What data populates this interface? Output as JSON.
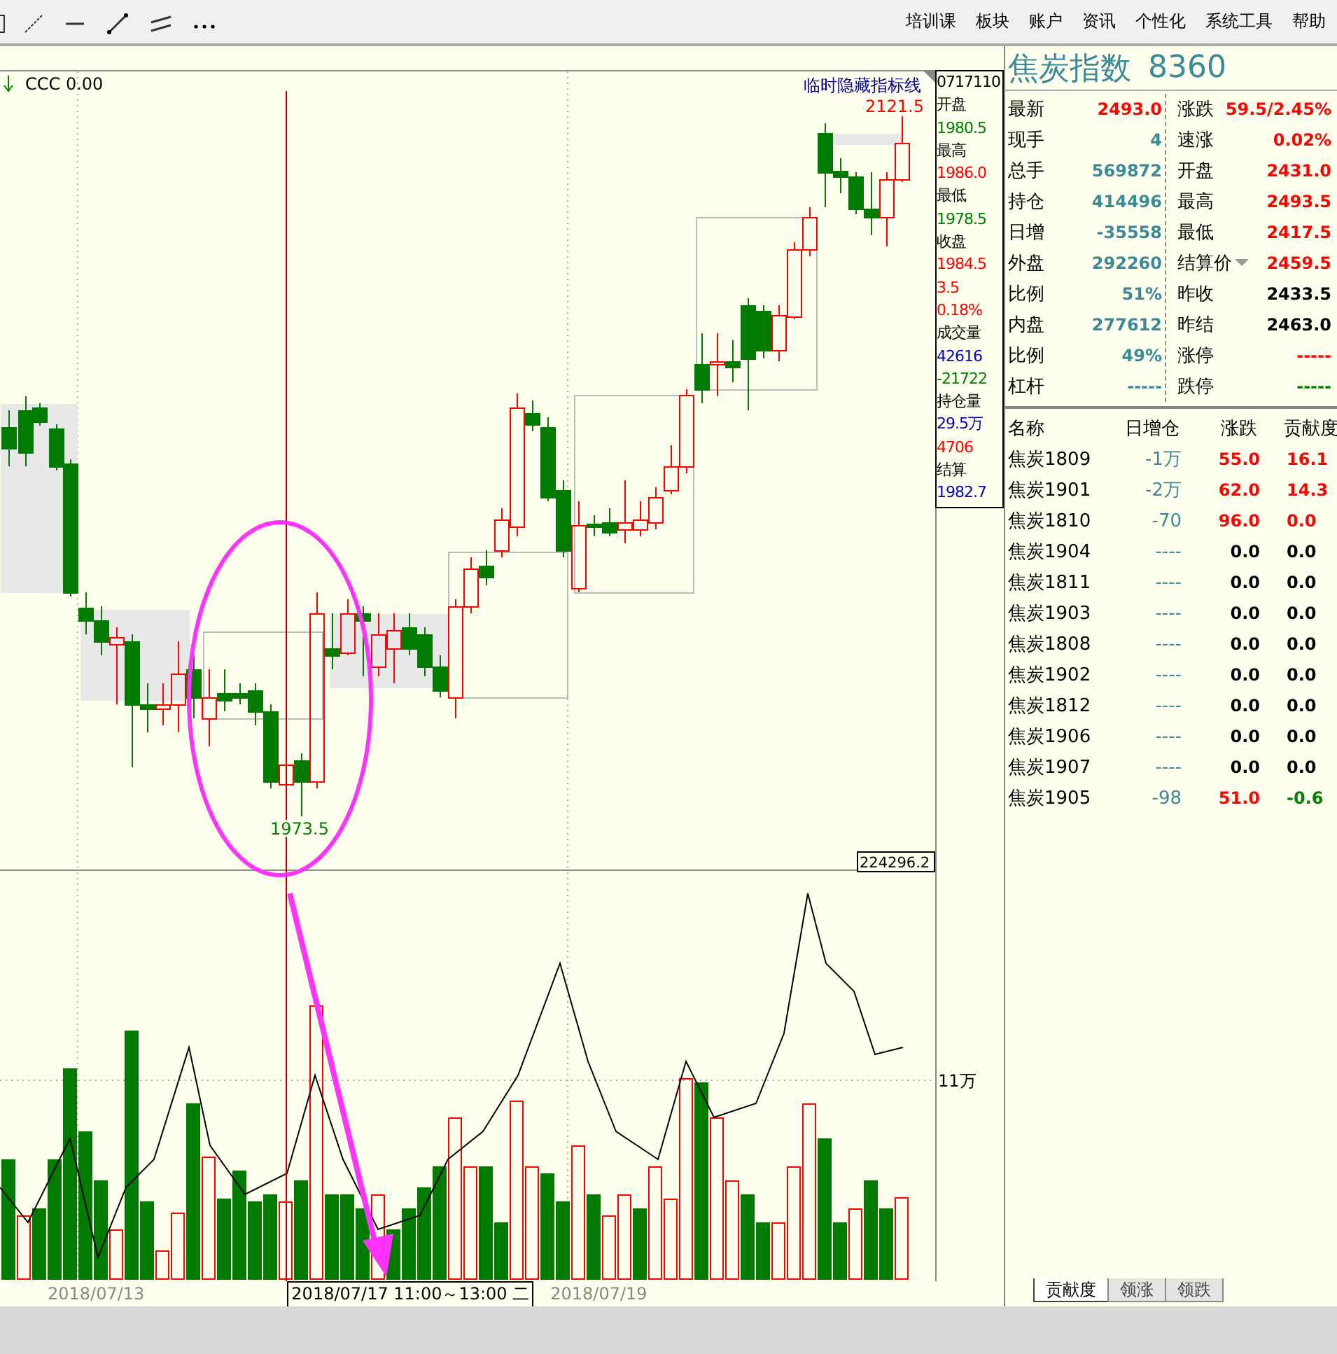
{
  "menu": [
    {
      "label": "培训课"
    },
    {
      "label": "板块"
    },
    {
      "label": "账户"
    },
    {
      "label": "资讯"
    },
    {
      "label": "个性化"
    },
    {
      "label": "系统工具"
    },
    {
      "label": "帮助"
    }
  ],
  "chart": {
    "indicator": "CCC 0.00",
    "hide_button": "临时隐藏指标线",
    "high_label": "2121.5",
    "low_label": "1973.5",
    "cursor_value": "224296.2",
    "volume_tick": "11万",
    "date_labels": [
      "2018/07/13",
      "2018/07/19"
    ],
    "cursor_date": "2018/07/17 11:00～13:00 二"
  },
  "info_box": [
    {
      "text": "0717110",
      "color": "#000000"
    },
    {
      "text": "开盘",
      "color": "#000000"
    },
    {
      "text": "1980.5",
      "color": "#008000"
    },
    {
      "text": "最高",
      "color": "#000000"
    },
    {
      "text": "1986.0",
      "color": "#ff0000"
    },
    {
      "text": "最低",
      "color": "#000000"
    },
    {
      "text": "1978.5",
      "color": "#008000"
    },
    {
      "text": "收盘",
      "color": "#000000"
    },
    {
      "text": "1984.5",
      "color": "#ff0000"
    },
    {
      "text": "3.5",
      "color": "#ff0000"
    },
    {
      "text": "0.18%",
      "color": "#ff0000"
    },
    {
      "text": "成交量",
      "color": "#000000"
    },
    {
      "text": "42616",
      "color": "#0000c0"
    },
    {
      "text": "-21722",
      "color": "#008000"
    },
    {
      "text": "持仓量",
      "color": "#000000"
    },
    {
      "text": "29.5万",
      "color": "#0000c0"
    },
    {
      "text": "4706",
      "color": "#ff0000"
    },
    {
      "text": "结算",
      "color": "#000000"
    },
    {
      "text": "1982.7",
      "color": "#0000c0"
    }
  ],
  "quote": {
    "title": "焦炭指数",
    "code": "8360",
    "left": [
      {
        "label": "最新",
        "value": "2493.0",
        "color": "#ff0000"
      },
      {
        "label": "现手",
        "value": "4",
        "color": "#3a8a9a"
      },
      {
        "label": "总手",
        "value": "569872",
        "color": "#3a8a9a"
      },
      {
        "label": "持仓",
        "value": "414496",
        "color": "#3a8a9a"
      },
      {
        "label": "日增",
        "value": "-35558",
        "color": "#3a8a9a"
      },
      {
        "label": "外盘",
        "value": "292260",
        "color": "#3a8a9a"
      },
      {
        "label": "比例",
        "value": "51%",
        "color": "#3a8a9a"
      },
      {
        "label": "内盘",
        "value": "277612",
        "color": "#3a8a9a"
      },
      {
        "label": "比例",
        "value": "49%",
        "color": "#3a8a9a"
      },
      {
        "label": "杠杆",
        "value": "-----",
        "color": "#3a8a9a"
      }
    ],
    "right": [
      {
        "label": "涨跌",
        "value": "59.5/2.45%",
        "color": "#ff0000",
        "dropdown": false
      },
      {
        "label": "速涨",
        "value": "0.02%",
        "color": "#ff0000",
        "dropdown": false
      },
      {
        "label": "开盘",
        "value": "2431.0",
        "color": "#ff0000",
        "dropdown": false
      },
      {
        "label": "最高",
        "value": "2493.5",
        "color": "#ff0000",
        "dropdown": false
      },
      {
        "label": "最低",
        "value": "2417.5",
        "color": "#ff0000",
        "dropdown": false
      },
      {
        "label": "结算价",
        "value": "2459.5",
        "color": "#ff0000",
        "dropdown": true
      },
      {
        "label": "昨收",
        "value": "2433.5",
        "color": "#000000",
        "dropdown": false
      },
      {
        "label": "昨结",
        "value": "2463.0",
        "color": "#000000",
        "dropdown": false
      },
      {
        "label": "涨停",
        "value": "-----",
        "color": "#ff0000",
        "dropdown": false
      },
      {
        "label": "跌停",
        "value": "-----",
        "color": "#008000",
        "dropdown": false
      }
    ]
  },
  "contracts": {
    "columns": [
      "名称",
      "日增仓",
      "涨跌",
      "贡献度"
    ],
    "rows": [
      {
        "name": "焦炭1809",
        "oi": "-1万",
        "change": {
          "text": "55.0",
          "color": "#ff0000"
        },
        "contribution": {
          "text": "16.1",
          "color": "#ff0000"
        }
      },
      {
        "name": "焦炭1901",
        "oi": "-2万",
        "change": {
          "text": "62.0",
          "color": "#ff0000"
        },
        "contribution": {
          "text": "14.3",
          "color": "#ff0000"
        }
      },
      {
        "name": "焦炭1810",
        "oi": "-70",
        "change": {
          "text": "96.0",
          "color": "#ff0000"
        },
        "contribution": {
          "text": "0.0",
          "color": "#ff0000"
        }
      },
      {
        "name": "焦炭1904",
        "oi": "----",
        "change": {
          "text": "0.0",
          "color": "#000000"
        },
        "contribution": {
          "text": "0.0",
          "color": "#000000"
        }
      },
      {
        "name": "焦炭1811",
        "oi": "----",
        "change": {
          "text": "0.0",
          "color": "#000000"
        },
        "contribution": {
          "text": "0.0",
          "color": "#000000"
        }
      },
      {
        "name": "焦炭1903",
        "oi": "----",
        "change": {
          "text": "0.0",
          "color": "#000000"
        },
        "contribution": {
          "text": "0.0",
          "color": "#000000"
        }
      },
      {
        "name": "焦炭1808",
        "oi": "----",
        "change": {
          "text": "0.0",
          "color": "#000000"
        },
        "contribution": {
          "text": "0.0",
          "color": "#000000"
        }
      },
      {
        "name": "焦炭1902",
        "oi": "----",
        "change": {
          "text": "0.0",
          "color": "#000000"
        },
        "contribution": {
          "text": "0.0",
          "color": "#000000"
        }
      },
      {
        "name": "焦炭1812",
        "oi": "----",
        "change": {
          "text": "0.0",
          "color": "#000000"
        },
        "contribution": {
          "text": "0.0",
          "color": "#000000"
        }
      },
      {
        "name": "焦炭1906",
        "oi": "----",
        "change": {
          "text": "0.0",
          "color": "#000000"
        },
        "contribution": {
          "text": "0.0",
          "color": "#000000"
        }
      },
      {
        "name": "焦炭1907",
        "oi": "----",
        "change": {
          "text": "0.0",
          "color": "#000000"
        },
        "contribution": {
          "text": "0.0",
          "color": "#000000"
        }
      },
      {
        "name": "焦炭1905",
        "oi": "-98",
        "change": {
          "text": "51.0",
          "color": "#ff0000"
        },
        "contribution": {
          "text": "-0.6",
          "color": "#008000"
        }
      }
    ]
  },
  "tabs": [
    {
      "label": "贡献度",
      "selected": true
    },
    {
      "label": "领涨",
      "selected": false
    },
    {
      "label": "领跌",
      "selected": false
    }
  ]
}
